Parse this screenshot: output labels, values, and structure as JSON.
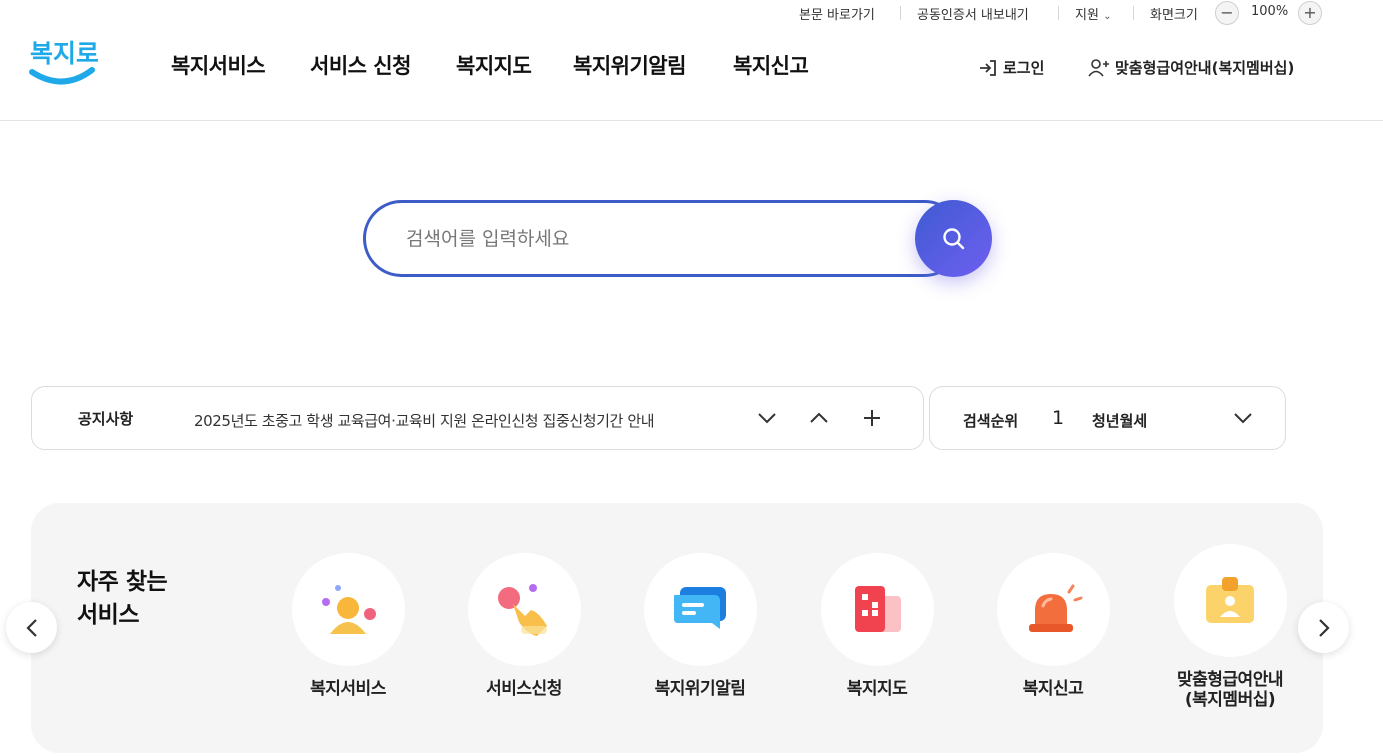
{
  "util": {
    "skip_link": "본문 바로가기",
    "cert_export": "공동인증서 내보내기",
    "support": "지원",
    "zoom_label": "화면크기",
    "zoom_value": "100%"
  },
  "header": {
    "logo_text": "복지로",
    "nav": [
      "복지서비스",
      "서비스 신청",
      "복지지도",
      "복지위기알림",
      "복지신고"
    ],
    "login": "로그인",
    "membership": "맞춤형급여안내(복지멤버십)"
  },
  "search": {
    "placeholder": "검색어를 입력하세요"
  },
  "notice": {
    "label": "공지사항",
    "text": "2025년도 초중고 학생 교육급여·교육비 지원 온라인신청 집중신청기간 안내"
  },
  "ranking": {
    "label": "검색순위",
    "rank": "1",
    "term": "청년월세"
  },
  "frequent": {
    "title_line1": "자주 찾는",
    "title_line2": "서비스",
    "items": [
      {
        "label": "복지서비스",
        "icon": "person-icon"
      },
      {
        "label": "서비스신청",
        "icon": "hand-click-icon"
      },
      {
        "label": "복지위기알림",
        "icon": "message-icon"
      },
      {
        "label": "복지지도",
        "icon": "building-icon"
      },
      {
        "label": "복지신고",
        "icon": "siren-icon"
      },
      {
        "label": "맞춤형급여안내",
        "label2": "(복지멤버십)",
        "icon": "id-card-icon"
      }
    ]
  },
  "colors": {
    "accent": "#3d5cc8",
    "brand_blue": "#1fa9e8"
  }
}
